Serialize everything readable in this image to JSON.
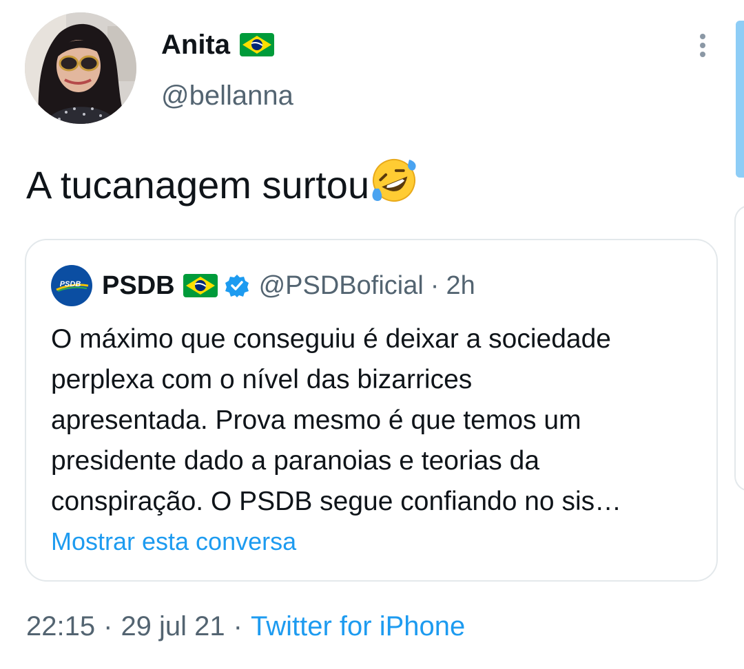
{
  "author": {
    "display_name": "Anita",
    "flag_icon": "brazil-flag-icon",
    "handle": "@bellanna",
    "avatar_icon": "profile-photo"
  },
  "tweet": {
    "text": "A tucanagem surtou",
    "emoji_icon": "rolling-on-the-floor-laughing-emoji"
  },
  "quoted_tweet": {
    "avatar_logo_text": "PSDB",
    "name": "PSDB",
    "flag_icon": "brazil-flag-icon",
    "verified_icon": "verified-badge-icon",
    "handle": "@PSDBoficial",
    "dot": "·",
    "time": "2h",
    "lines": [
      "O máximo que conseguiu é deixar a sociedade",
      "perplexa com o nível das bizarrices",
      "apresentada.  Prova mesmo é que temos um",
      "presidente dado a paranoias e teorias da",
      "conspiração. O PSDB segue confiando no sis…"
    ],
    "show_thread_link": "Mostrar esta conversa"
  },
  "meta": {
    "time": "22:15",
    "sep1": "·",
    "date": "29 jul 21",
    "sep2": "·",
    "source": "Twitter for iPhone"
  },
  "colors": {
    "link": "#1d9bf0",
    "secondary_text": "#536471",
    "border": "#e3e8eb",
    "verified": "#1d9bf0",
    "psdb_blue": "#0b4ea2"
  }
}
